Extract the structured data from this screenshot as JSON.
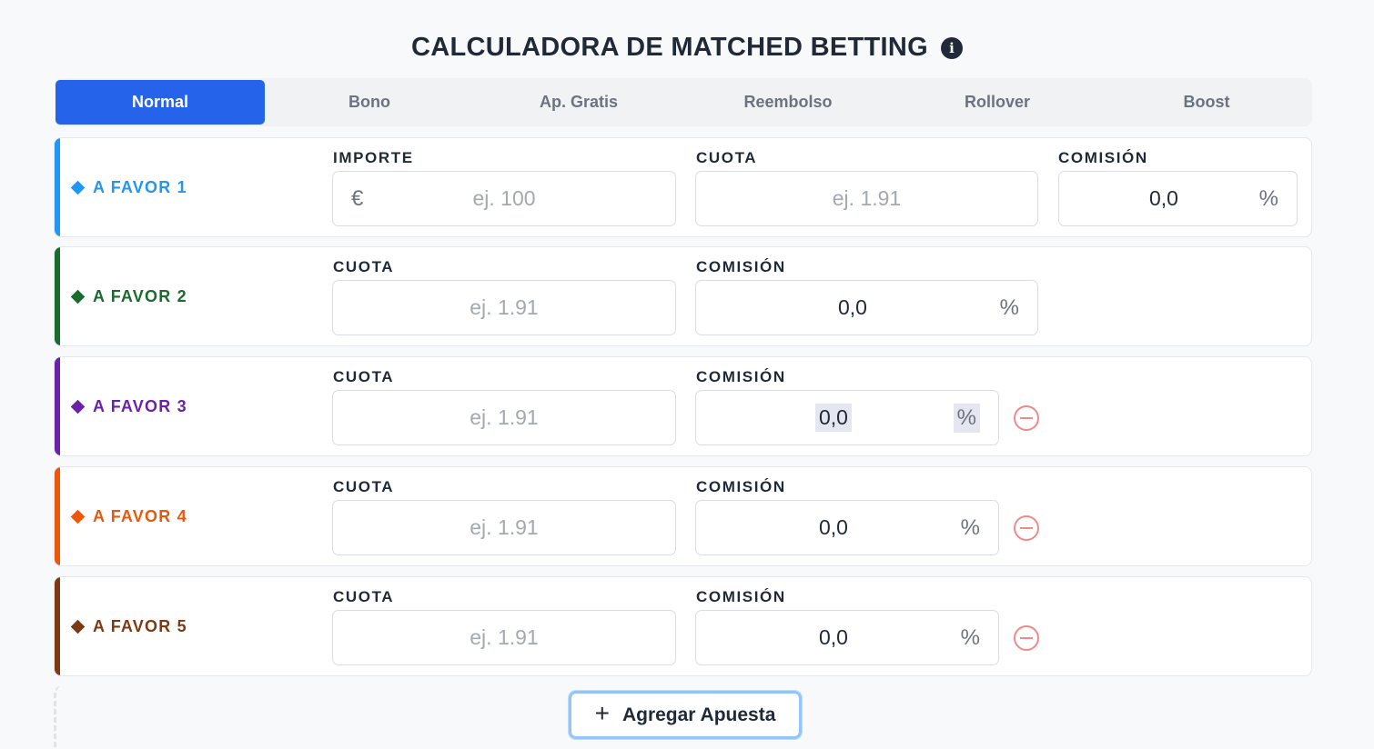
{
  "header": {
    "title": "CALCULADORA DE MATCHED BETTING",
    "info_icon": "info-circle-icon"
  },
  "tabs": [
    {
      "label": "Normal",
      "active": true
    },
    {
      "label": "Bono",
      "active": false
    },
    {
      "label": "Ap. Gratis",
      "active": false
    },
    {
      "label": "Reembolso",
      "active": false
    },
    {
      "label": "Rollover",
      "active": false
    },
    {
      "label": "Boost",
      "active": false
    }
  ],
  "rows": [
    {
      "label": "A FAVOR 1",
      "color": "#2196f3",
      "importe": {
        "label": "IMPORTE",
        "prefix": "€",
        "placeholder": "ej. 100"
      },
      "cuota": {
        "label": "CUOTA",
        "placeholder": "ej. 1.91"
      },
      "comision": {
        "label": "COMISIÓN",
        "value": "0,0",
        "unit": "%"
      }
    },
    {
      "label": "A FAVOR 2",
      "color": "#1b6b2f",
      "cuota": {
        "label": "CUOTA",
        "placeholder": "ej. 1.91"
      },
      "comision": {
        "label": "COMISIÓN",
        "value": "0,0",
        "unit": "%"
      }
    },
    {
      "label": "A FAVOR 3",
      "color": "#6b21a8",
      "cuota": {
        "label": "CUOTA",
        "placeholder": "ej. 1.91"
      },
      "comision": {
        "label": "COMISIÓN",
        "value": "0,0",
        "unit": "%"
      }
    },
    {
      "label": "A FAVOR 4",
      "color": "#ea580c",
      "cuota": {
        "label": "CUOTA",
        "placeholder": "ej. 1.91"
      },
      "comision": {
        "label": "COMISIÓN",
        "value": "0,0",
        "unit": "%"
      }
    },
    {
      "label": "A FAVOR 5",
      "color": "#7c3a12",
      "cuota": {
        "label": "CUOTA",
        "placeholder": "ej. 1.91"
      },
      "comision": {
        "label": "COMISIÓN",
        "value": "0,0",
        "unit": "%"
      }
    }
  ],
  "add_button": {
    "label": "Agregar Apuesta",
    "icon": "plus-icon"
  },
  "colors": {
    "accent": "#2563eb",
    "remove": "#f08a8a",
    "focus_ring": "#93c5fd"
  }
}
